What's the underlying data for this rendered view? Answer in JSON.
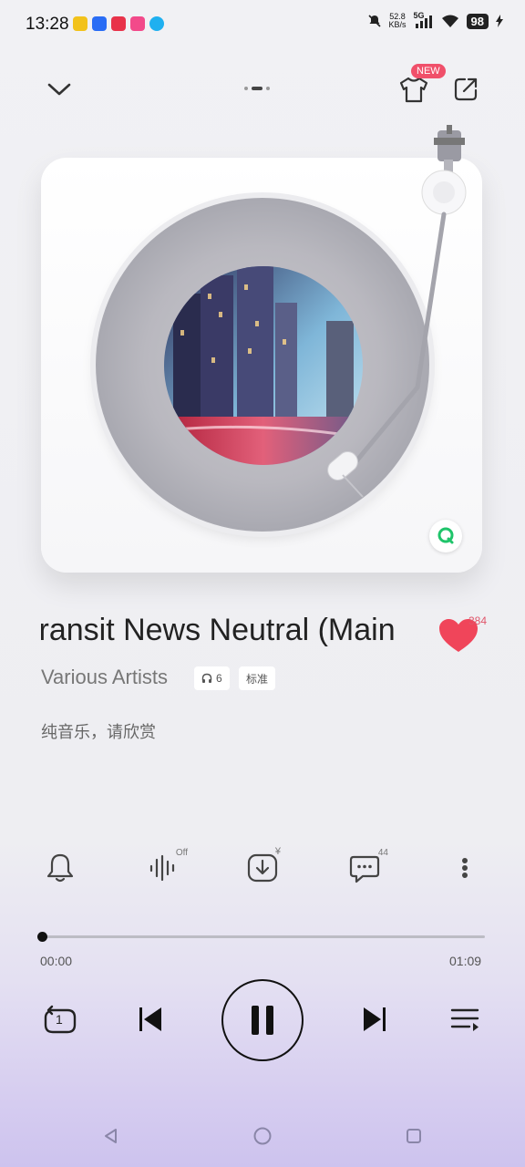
{
  "status_bar": {
    "time": "13:28",
    "net_speed_value": "52.8",
    "net_speed_unit": "KB/s",
    "network": "5G",
    "battery": "98",
    "app_icon_colors": [
      "#f2c21b",
      "#2a6df5",
      "#e8334a",
      "#f24a8a",
      "#1fb0f0"
    ]
  },
  "top_nav": {
    "collapse_icon": "chevron-down-icon",
    "skin_icon": "tshirt-icon",
    "skin_badge": "NEW",
    "share_icon": "share-icon",
    "page_indicator": {
      "count": 3,
      "active": 1
    }
  },
  "player": {
    "song_title": "Transit News Neutral (Main",
    "artist": "Various Artists",
    "listeners_count": "6",
    "quality_label": "标准",
    "lyric_line": "纯音乐，请欣赏",
    "like_count": "384",
    "liked": true,
    "accent_color": "#f0455a"
  },
  "actions": {
    "ringtone_icon": "bell-icon",
    "sound_effect_icon": "soundwave-icon",
    "sound_effect_state": "Off",
    "download_icon": "download-paid-icon",
    "download_badge": "¥",
    "comment_icon": "comment-icon",
    "comment_count": "44",
    "more_icon": "more-vertical-icon"
  },
  "progress": {
    "current": "00:00",
    "total": "01:09",
    "fraction": 0.0
  },
  "controls": {
    "repeat_mode_icon": "repeat-one-icon",
    "repeat_mode_label": "1",
    "prev_icon": "skip-previous-icon",
    "play_state": "playing",
    "pause_icon": "pause-icon",
    "next_icon": "skip-next-icon",
    "playlist_icon": "playlist-icon"
  },
  "system_nav": {
    "back_icon": "back-triangle-icon",
    "home_icon": "home-circle-icon",
    "recents_icon": "recents-square-icon"
  }
}
